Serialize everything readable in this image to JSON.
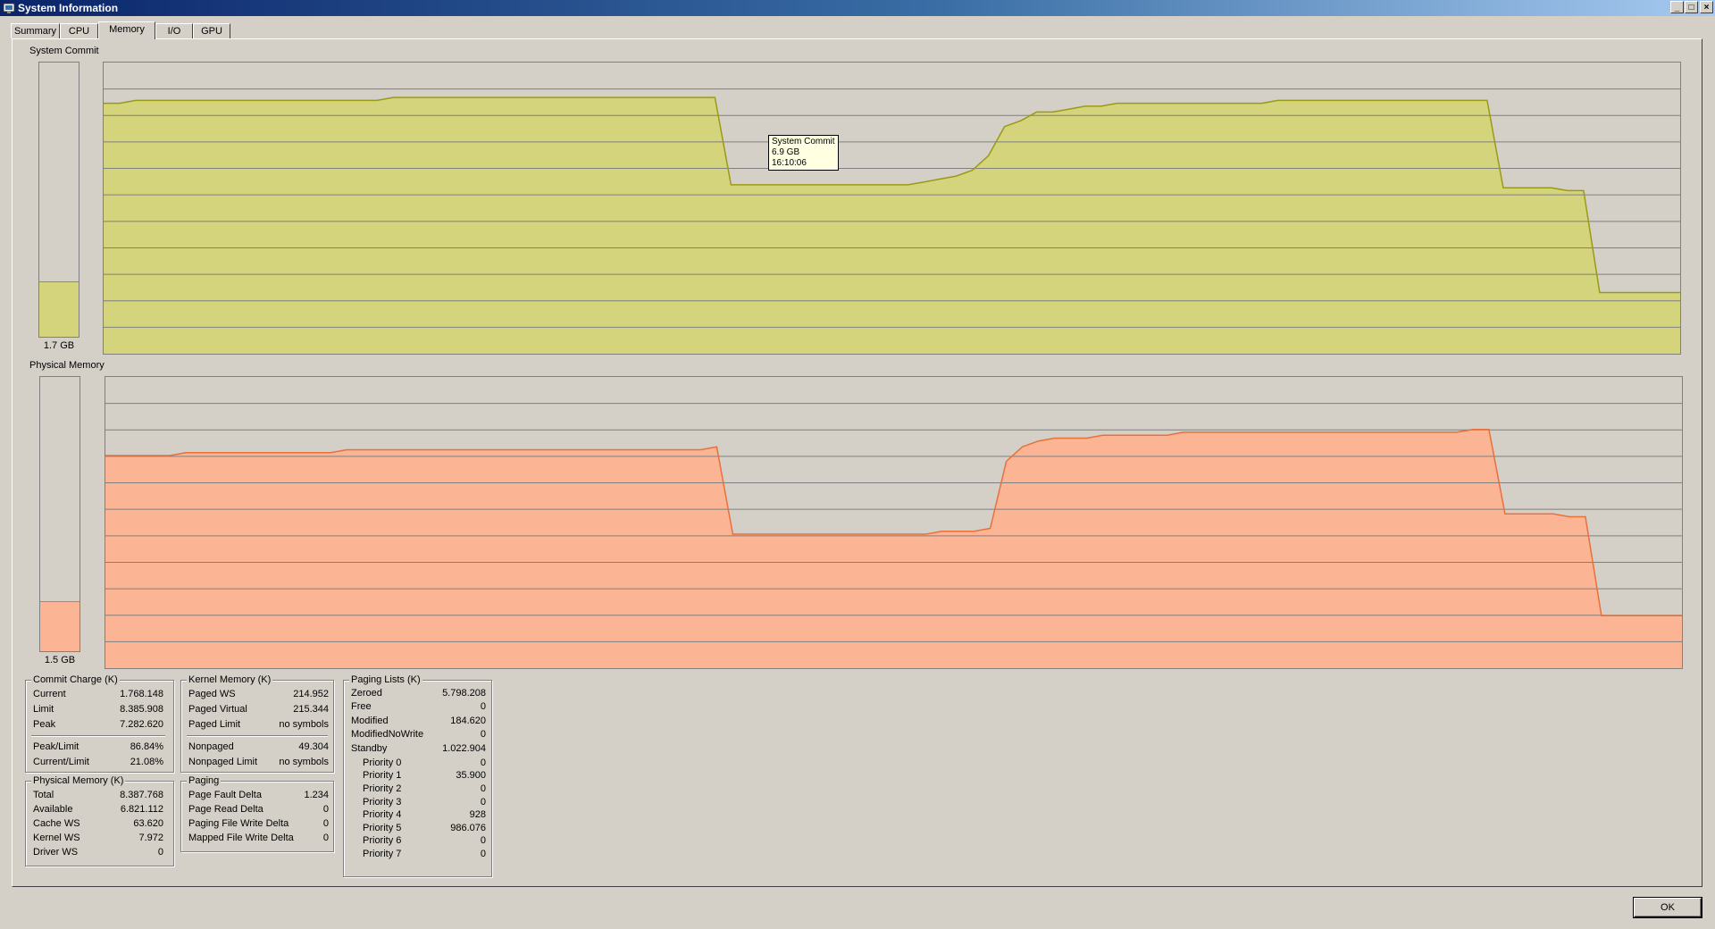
{
  "window": {
    "title": "System Information",
    "buttons": {
      "minimize": "_",
      "maximize": "□",
      "close": "×"
    }
  },
  "tabs": [
    "Summary",
    "CPU",
    "Memory",
    "I/O",
    "GPU"
  ],
  "active_tab": "Memory",
  "graphs": {
    "commit": {
      "label": "System Commit",
      "meter_value": "1.7 GB",
      "meter_fraction": 0.2,
      "color_fill": "#d4d47c",
      "color_line": "#9a9a14",
      "history_fraction": [
        0.86,
        0.86,
        0.87,
        0.87,
        0.87,
        0.87,
        0.87,
        0.87,
        0.87,
        0.87,
        0.87,
        0.87,
        0.87,
        0.87,
        0.87,
        0.87,
        0.87,
        0.87,
        0.88,
        0.88,
        0.88,
        0.88,
        0.88,
        0.88,
        0.88,
        0.88,
        0.88,
        0.88,
        0.88,
        0.88,
        0.88,
        0.88,
        0.88,
        0.88,
        0.88,
        0.88,
        0.88,
        0.88,
        0.88,
        0.58,
        0.58,
        0.58,
        0.58,
        0.58,
        0.58,
        0.58,
        0.58,
        0.58,
        0.58,
        0.58,
        0.58,
        0.59,
        0.6,
        0.61,
        0.63,
        0.68,
        0.78,
        0.8,
        0.83,
        0.83,
        0.84,
        0.85,
        0.85,
        0.86,
        0.86,
        0.86,
        0.86,
        0.86,
        0.86,
        0.86,
        0.86,
        0.86,
        0.86,
        0.87,
        0.87,
        0.87,
        0.87,
        0.87,
        0.87,
        0.87,
        0.87,
        0.87,
        0.87,
        0.87,
        0.87,
        0.87,
        0.87,
        0.57,
        0.57,
        0.57,
        0.57,
        0.56,
        0.56,
        0.21,
        0.21,
        0.21,
        0.21,
        0.21,
        0.21
      ],
      "tooltip": {
        "series": "System Commit",
        "value": "6.9 GB",
        "time": "16:10:06"
      }
    },
    "physical": {
      "label": "Physical Memory",
      "meter_value": "1.5 GB",
      "meter_fraction": 0.18,
      "color_fill": "#fbb594",
      "color_line": "#e8703a",
      "history_fraction": [
        0.73,
        0.73,
        0.73,
        0.73,
        0.73,
        0.74,
        0.74,
        0.74,
        0.74,
        0.74,
        0.74,
        0.74,
        0.74,
        0.74,
        0.74,
        0.75,
        0.75,
        0.75,
        0.75,
        0.75,
        0.75,
        0.75,
        0.75,
        0.75,
        0.75,
        0.75,
        0.75,
        0.75,
        0.75,
        0.75,
        0.75,
        0.75,
        0.75,
        0.75,
        0.75,
        0.75,
        0.75,
        0.75,
        0.76,
        0.46,
        0.46,
        0.46,
        0.46,
        0.46,
        0.46,
        0.46,
        0.46,
        0.46,
        0.46,
        0.46,
        0.46,
        0.46,
        0.47,
        0.47,
        0.47,
        0.48,
        0.71,
        0.76,
        0.78,
        0.79,
        0.79,
        0.79,
        0.8,
        0.8,
        0.8,
        0.8,
        0.8,
        0.81,
        0.81,
        0.81,
        0.81,
        0.81,
        0.81,
        0.81,
        0.81,
        0.81,
        0.81,
        0.81,
        0.81,
        0.81,
        0.81,
        0.81,
        0.81,
        0.81,
        0.81,
        0.82,
        0.82,
        0.53,
        0.53,
        0.53,
        0.53,
        0.52,
        0.52,
        0.18,
        0.18,
        0.18,
        0.18,
        0.18,
        0.18
      ]
    }
  },
  "commit_charge": {
    "title": "Commit Charge (K)",
    "rows": [
      {
        "k": "Current",
        "v": "1.768.148"
      },
      {
        "k": "Limit",
        "v": "8.385.908"
      },
      {
        "k": "Peak",
        "v": "7.282.620"
      }
    ],
    "rows2": [
      {
        "k": "Peak/Limit",
        "v": "86.84%"
      },
      {
        "k": "Current/Limit",
        "v": "21.08%"
      }
    ]
  },
  "physical_memory": {
    "title": "Physical Memory (K)",
    "rows": [
      {
        "k": "Total",
        "v": "8.387.768"
      },
      {
        "k": "Available",
        "v": "6.821.112"
      },
      {
        "k": "Cache WS",
        "v": "63.620"
      },
      {
        "k": "Kernel WS",
        "v": "7.972"
      },
      {
        "k": "Driver WS",
        "v": "0"
      }
    ]
  },
  "kernel_memory": {
    "title": "Kernel Memory (K)",
    "rows": [
      {
        "k": "Paged WS",
        "v": "214.952"
      },
      {
        "k": "Paged Virtual",
        "v": "215.344"
      },
      {
        "k": "Paged Limit",
        "v": "no symbols"
      }
    ],
    "rows2": [
      {
        "k": "Nonpaged",
        "v": "49.304"
      },
      {
        "k": "Nonpaged Limit",
        "v": "no symbols"
      }
    ]
  },
  "paging": {
    "title": "Paging",
    "rows": [
      {
        "k": "Page Fault Delta",
        "v": "1.234"
      },
      {
        "k": "Page Read Delta",
        "v": "0"
      },
      {
        "k": "Paging File Write Delta",
        "v": "0"
      },
      {
        "k": "Mapped File Write Delta",
        "v": "0"
      }
    ]
  },
  "paging_lists": {
    "title": "Paging Lists (K)",
    "rows": [
      {
        "k": "Zeroed",
        "v": "5.798.208"
      },
      {
        "k": "Free",
        "v": "0"
      },
      {
        "k": "Modified",
        "v": "184.620"
      },
      {
        "k": "ModifiedNoWrite",
        "v": "0"
      },
      {
        "k": "Standby",
        "v": "1.022.904"
      }
    ],
    "priorities": [
      {
        "k": "Priority 0",
        "v": "0"
      },
      {
        "k": "Priority 1",
        "v": "35.900"
      },
      {
        "k": "Priority 2",
        "v": "0"
      },
      {
        "k": "Priority 3",
        "v": "0"
      },
      {
        "k": "Priority 4",
        "v": "928"
      },
      {
        "k": "Priority 5",
        "v": "986.076"
      },
      {
        "k": "Priority 6",
        "v": "0"
      },
      {
        "k": "Priority 7",
        "v": "0"
      }
    ]
  },
  "ok_button": "OK"
}
